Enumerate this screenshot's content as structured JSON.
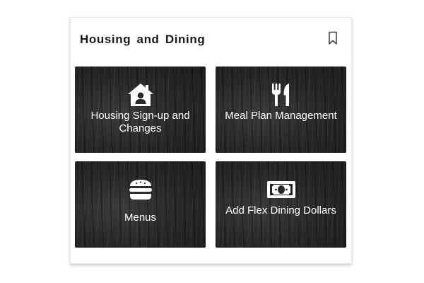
{
  "card": {
    "title": "Housing and Dining",
    "bookmark_icon": "bookmark-outline-icon"
  },
  "tiles": [
    {
      "label": "Housing Sign-up and Changes",
      "icon": "house-user-icon"
    },
    {
      "label": "Meal Plan Management",
      "icon": "fork-knife-icon"
    },
    {
      "label": "Menus",
      "icon": "burger-icon"
    },
    {
      "label": "Add Flex Dining Dollars",
      "icon": "money-bill-icon"
    }
  ],
  "colors": {
    "tile_background": "#262626",
    "tile_text": "#ffffff",
    "title_text": "#1a1a1a"
  }
}
